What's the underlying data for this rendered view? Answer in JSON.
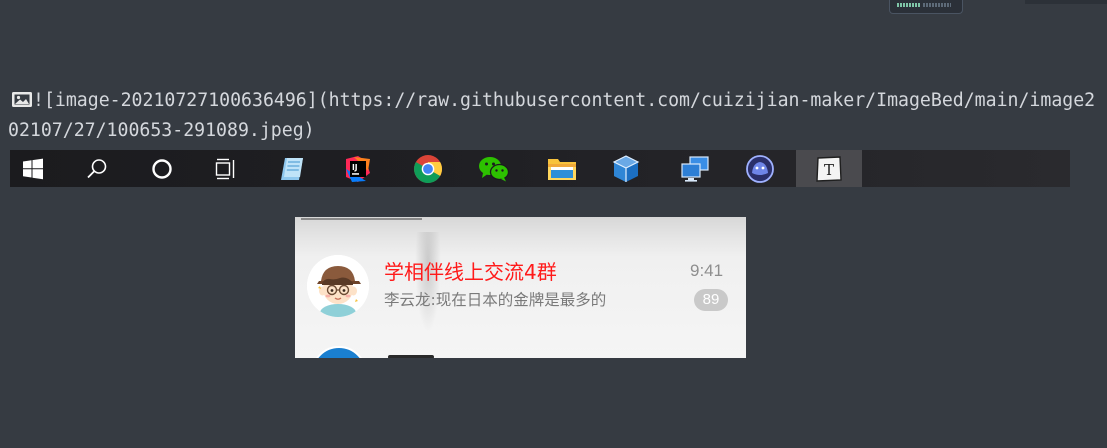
{
  "markdown": {
    "icon": "image-icon",
    "text": "![image-20210727100636496](https://raw.githubusercontent.com/cuizijian-maker/ImageBed/main/image202107/27/100653-291089.jpeg)"
  },
  "taskbar": {
    "items": [
      {
        "icon": "windows-start-icon"
      },
      {
        "icon": "search-icon"
      },
      {
        "icon": "cortana-icon"
      },
      {
        "icon": "task-view-icon"
      },
      {
        "icon": "notepad-app-icon"
      },
      {
        "icon": "intellij-idea-icon"
      },
      {
        "icon": "chrome-icon"
      },
      {
        "icon": "wechat-icon"
      },
      {
        "icon": "file-explorer-icon"
      },
      {
        "icon": "virtualbox-icon"
      },
      {
        "icon": "remote-desktop-icon"
      },
      {
        "icon": "round-app-icon"
      },
      {
        "icon": "typora-icon",
        "letter": "T",
        "active": true
      }
    ]
  },
  "chat": {
    "name": "学相伴线上交流4群",
    "time": "9:41",
    "preview": "李云龙:现在日本的金牌是最多的",
    "unread": "89",
    "name_color": "#ff1a1a"
  }
}
